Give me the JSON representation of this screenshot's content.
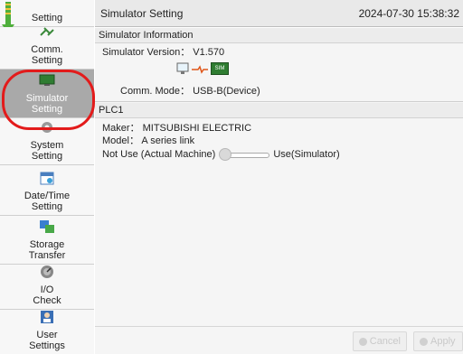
{
  "sidebar": {
    "items": [
      {
        "label": "Setting",
        "icon": "gear-icon"
      },
      {
        "label": "Comm.\nSetting",
        "icon": "comm-icon"
      },
      {
        "label": "Simulator\nSetting",
        "icon": "simulator-icon",
        "active": true
      },
      {
        "label": "System\nSetting",
        "icon": "system-gear-icon"
      },
      {
        "label": "Date/Time\nSetting",
        "icon": "calendar-icon"
      },
      {
        "label": "Storage\nTransfer",
        "icon": "transfer-icon"
      },
      {
        "label": "I/O\nCheck",
        "icon": "io-gauge-icon"
      },
      {
        "label": "User\nSettings",
        "icon": "user-icon"
      }
    ]
  },
  "header": {
    "title": "Simulator Setting",
    "datetime": "2024-07-30 15:38:32"
  },
  "simulator_info": {
    "section_title": "Simulator Information",
    "version_label": "Simulator Version： V1.570",
    "comm_mode_label": "Comm. Mode： USB-B(Device)",
    "sim_badge": "SIM"
  },
  "plc": {
    "section_title": "PLC1",
    "maker": "Maker： MITSUBISHI ELECTRIC",
    "model": "Model： A series link",
    "toggle_off_label": "Not Use (Actual Machine)",
    "toggle_on_label": "Use(Simulator)"
  },
  "footer": {
    "cancel_label": "Cancel",
    "apply_label": "Apply"
  },
  "colors": {
    "highlight": "#e31b1b",
    "active_item": "#a9a9a9"
  }
}
